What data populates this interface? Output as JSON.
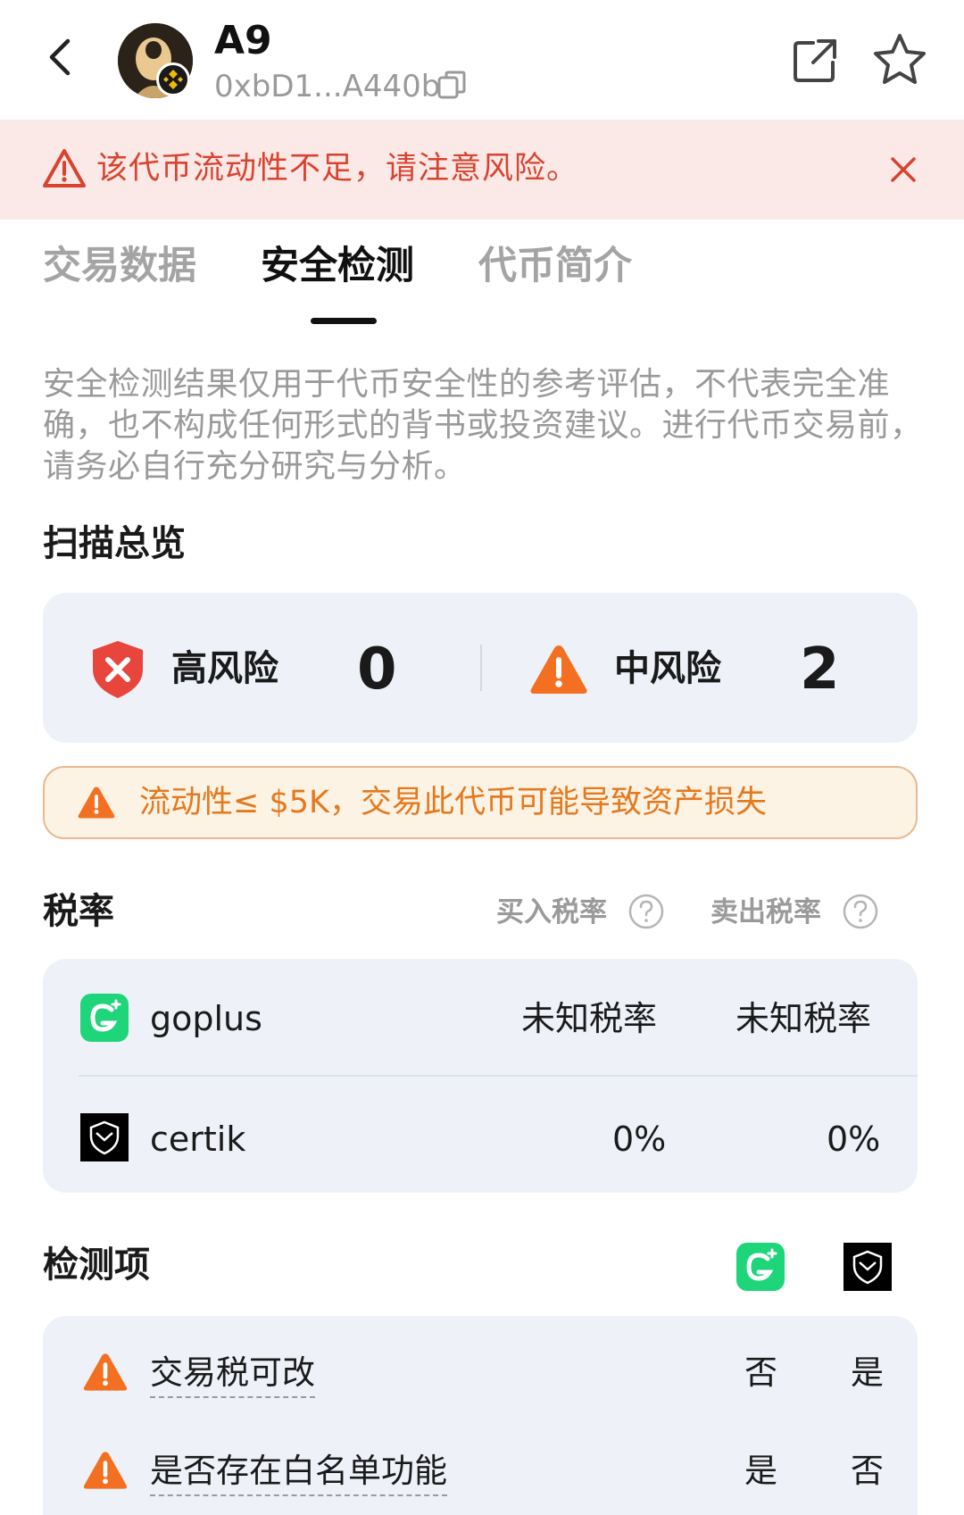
{
  "header": {
    "token_name": "A9",
    "token_address": "0xbD1...A440b"
  },
  "alert_banner": {
    "text": "该代币流动性不足，请注意风险。"
  },
  "tabs": [
    {
      "label": "交易数据",
      "active": false
    },
    {
      "label": "安全检测",
      "active": true
    },
    {
      "label": "代币简介",
      "active": false
    }
  ],
  "disclaimer": "安全检测结果仅用于代币安全性的参考评估，不代表完全准确，也不构成任何形式的背书或投资建议。进行代币交易前，请务必自行充分研究与分析。",
  "scan_overview": {
    "title": "扫描总览",
    "high_risk": {
      "label": "高风险",
      "count": "0"
    },
    "medium_risk": {
      "label": "中风险",
      "count": "2"
    }
  },
  "liquidity_warning": {
    "text": "流动性≤ $5K，交易此代币可能导致资产损失"
  },
  "tax": {
    "title": "税率",
    "buy_header": "买入税率",
    "sell_header": "卖出税率",
    "rows": [
      {
        "provider": "goplus",
        "buy": "未知税率",
        "sell": "未知税率"
      },
      {
        "provider": "certik",
        "buy": "0%",
        "sell": "0%"
      }
    ]
  },
  "detection": {
    "title": "检测项",
    "items": [
      {
        "label": "交易税可改",
        "goplus": "否",
        "certik": "是"
      },
      {
        "label": "是否存在白名单功能",
        "goplus": "是",
        "certik": "否"
      }
    ]
  },
  "colors": {
    "banner_bg": "#fbe9e7",
    "banner_text": "#d8432f",
    "warning_orange": "#f36f21",
    "high_risk_red": "#e8453c",
    "goplus_green": "#1fd57a",
    "card_bg": "#eef2f8"
  },
  "icons": [
    "back-arrow-icon",
    "copy-icon",
    "share-icon",
    "star-icon",
    "warning-icon",
    "close-icon",
    "shield-x-icon",
    "help-icon",
    "goplus-logo-icon",
    "certik-logo-icon"
  ]
}
